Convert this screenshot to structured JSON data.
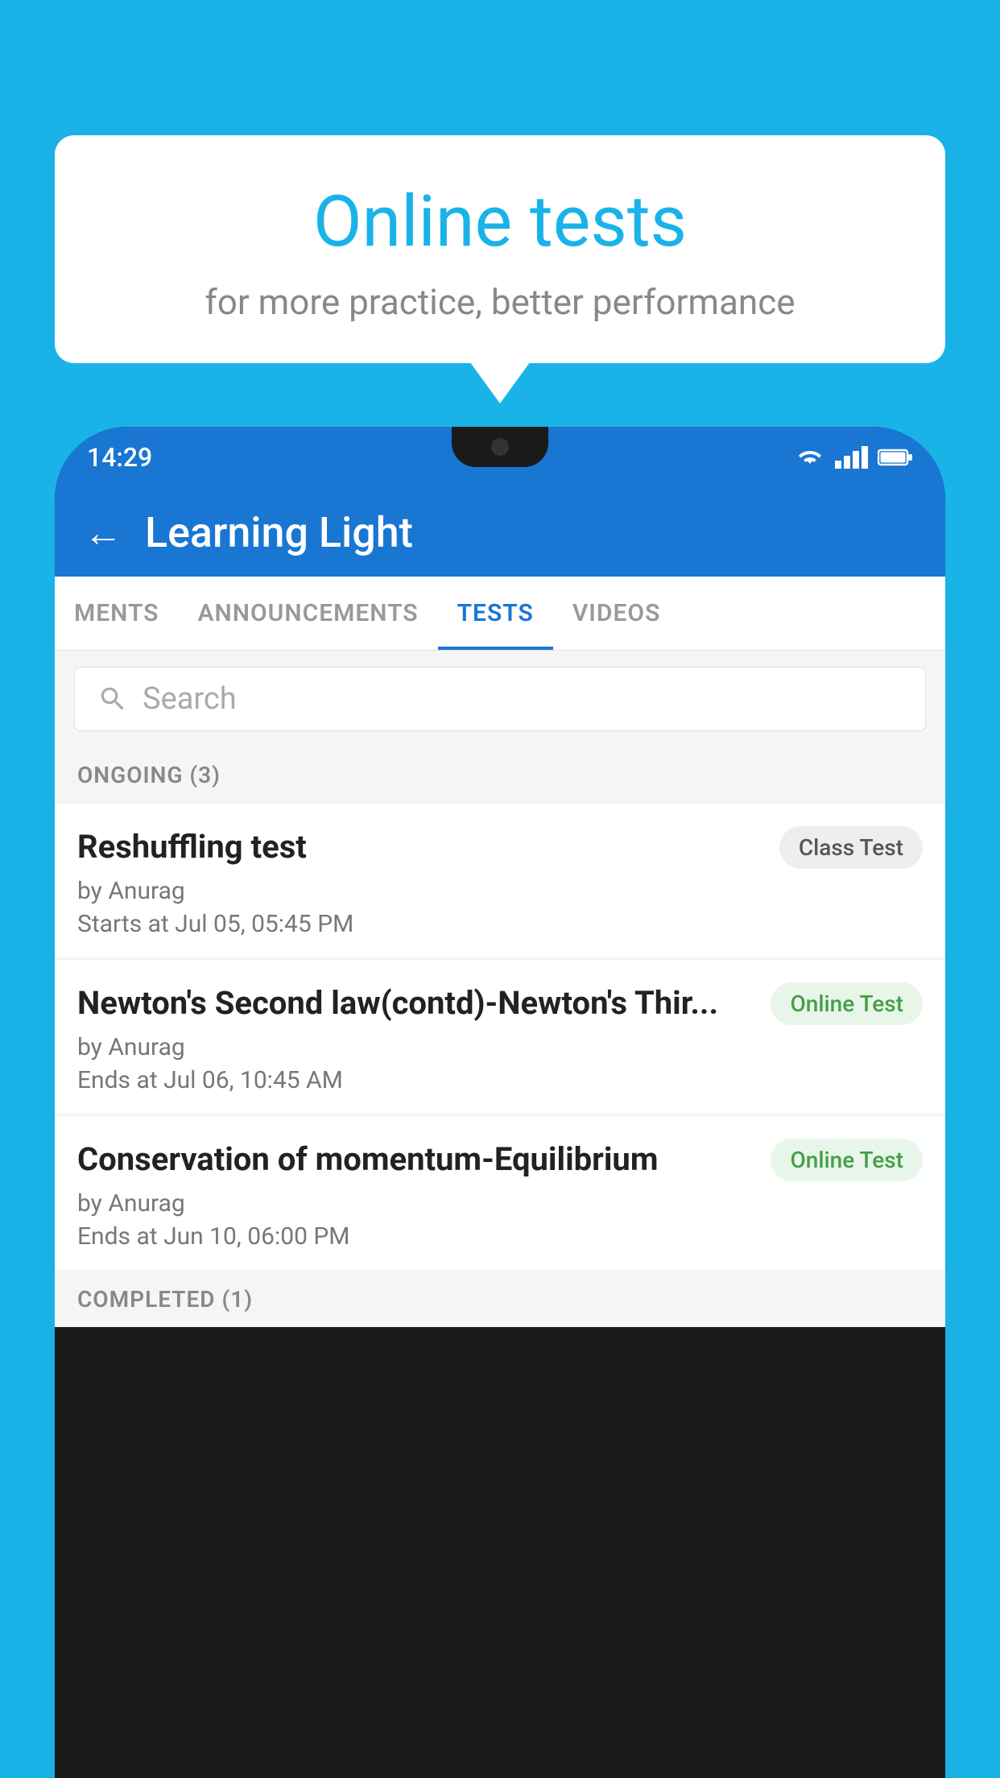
{
  "background": {
    "color": "#1ab3e8"
  },
  "speech_bubble": {
    "title": "Online tests",
    "subtitle": "for more practice, better performance"
  },
  "phone": {
    "status_bar": {
      "time": "14:29"
    },
    "app_bar": {
      "title": "Learning Light",
      "back_label": "←"
    },
    "tabs": [
      {
        "label": "MENTS",
        "active": false
      },
      {
        "label": "ANNOUNCEMENTS",
        "active": false
      },
      {
        "label": "TESTS",
        "active": true
      },
      {
        "label": "VIDEOS",
        "active": false
      }
    ],
    "search": {
      "placeholder": "Search"
    },
    "ongoing_section": {
      "label": "ONGOING (3)"
    },
    "tests": [
      {
        "title": "Reshuffling test",
        "badge": "Class Test",
        "badge_type": "class",
        "author": "by Anurag",
        "date_label": "Starts at",
        "date": "Jul 05, 05:45 PM"
      },
      {
        "title": "Newton's Second law(contd)-Newton's Thir...",
        "badge": "Online Test",
        "badge_type": "online",
        "author": "by Anurag",
        "date_label": "Ends at",
        "date": "Jul 06, 10:45 AM"
      },
      {
        "title": "Conservation of momentum-Equilibrium",
        "badge": "Online Test",
        "badge_type": "online",
        "author": "by Anurag",
        "date_label": "Ends at",
        "date": "Jun 10, 06:00 PM"
      }
    ],
    "completed_section": {
      "label": "COMPLETED (1)"
    }
  }
}
